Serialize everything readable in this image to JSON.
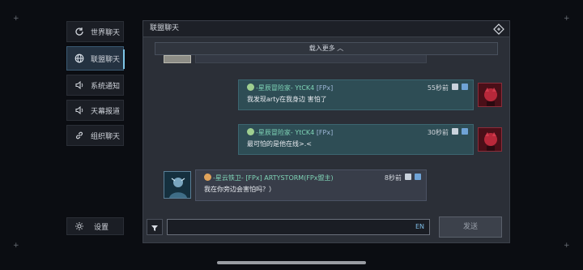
{
  "sidebar": {
    "items": [
      {
        "label": "世界聊天",
        "icon": "refresh-icon"
      },
      {
        "label": "联盟聊天",
        "icon": "globe-icon"
      },
      {
        "label": "系统通知",
        "icon": "speaker-icon"
      },
      {
        "label": "天幕报道",
        "icon": "speaker-icon"
      },
      {
        "label": "组织聊天",
        "icon": "link-icon"
      }
    ],
    "settings_label": "设置"
  },
  "panel": {
    "title": "联盟聊天",
    "load_more": "载入更多 ︿"
  },
  "messages": [
    {
      "side": "right",
      "name": "-星辰冒险家- YtCK4",
      "tag": "[FPx]",
      "time": "55秒前",
      "text": "我发现arty在我身边 害怕了"
    },
    {
      "side": "right",
      "name": "-星辰冒险家- YtCK4",
      "tag": "[FPx]",
      "time": "30秒前",
      "text": "最可怕的是他在线>.<"
    },
    {
      "side": "left",
      "name": "-星云铁卫- [FPx] ARTYSTORM(FPx盟主)",
      "tag": "",
      "time": "8秒前",
      "text": "我在你旁边会害怕吗？）"
    }
  ],
  "input": {
    "value": "",
    "lang": "EN",
    "send_label": "发送"
  },
  "colors": {
    "accent": "#7ec6e8",
    "name_green": "#7fd4b6",
    "mine_bubble": "#2e4d55",
    "other_bubble": "#383d49"
  }
}
